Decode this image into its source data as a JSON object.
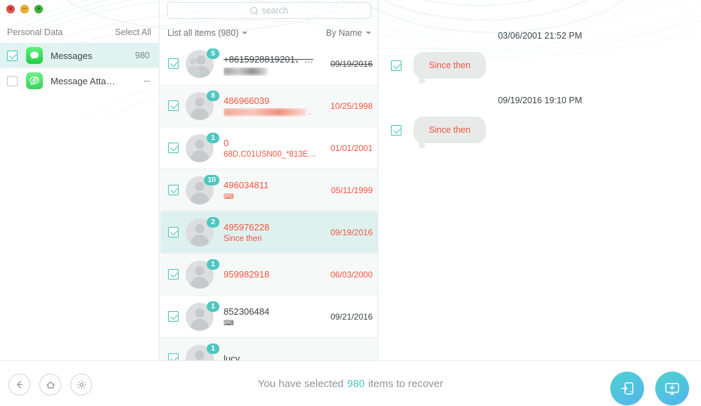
{
  "window": {
    "close_label": "×",
    "minimize_label": "−",
    "maximize_label": "+"
  },
  "sidebar": {
    "title": "Personal Data",
    "select_all_label": "Select All",
    "items": [
      {
        "label": "Messages",
        "count": "980",
        "checked": true,
        "icon": "messages-icon"
      },
      {
        "label": "Message Atta…",
        "count": "--",
        "checked": false,
        "icon": "message-attachments-icon"
      }
    ]
  },
  "list": {
    "search_placeholder": "search",
    "search_value": "",
    "filter_label": "List all items (980)",
    "sort_label": "By Name",
    "rows": [
      {
        "badge": "5",
        "title": "+8615928819201、…",
        "subtitle": "",
        "date": "09/19/2016",
        "red": false,
        "struck": true,
        "group": true,
        "sub_kind": "blur-gray",
        "sub_width": 62
      },
      {
        "badge": "8",
        "title": "486966039",
        "subtitle": "",
        "date": "10/25/1998",
        "red": true,
        "struck": false,
        "group": false,
        "sub_kind": "blur-red",
        "sub_width": 118
      },
      {
        "badge": "1",
        "title": "0",
        "subtitle": "68D.C01USN00_*813E…",
        "date": "01/01/2001",
        "red": true,
        "struck": false,
        "group": false,
        "sub_kind": "text",
        "sub_width": 0
      },
      {
        "badge": "10",
        "title": "496034811",
        "subtitle": "⌨",
        "date": "05/11/1999",
        "red": true,
        "struck": false,
        "group": false,
        "sub_kind": "glyph",
        "sub_width": 0
      },
      {
        "badge": "2",
        "title": "495976228",
        "subtitle": "Since then",
        "date": "09/19/2016",
        "red": true,
        "struck": false,
        "group": false,
        "sub_kind": "text",
        "sub_width": 0
      },
      {
        "badge": "1",
        "title": "959982918",
        "subtitle": "",
        "date": "06/03/2000",
        "red": true,
        "struck": false,
        "group": false,
        "sub_kind": "none",
        "sub_width": 0
      },
      {
        "badge": "1",
        "title": "852306484",
        "subtitle": "⌨",
        "date": "09/21/2016",
        "red": false,
        "struck": false,
        "group": false,
        "sub_kind": "glyph-dark",
        "sub_width": 0
      },
      {
        "badge": "1",
        "title": "lucy",
        "subtitle": "",
        "date": "",
        "red": false,
        "struck": false,
        "group": false,
        "sub_kind": "none",
        "sub_width": 0
      }
    ],
    "selected_index": 4
  },
  "chat": {
    "messages": [
      {
        "timestamp": "03/06/2001 21:52 PM",
        "text": "Since then",
        "checked": true
      },
      {
        "timestamp": "09/19/2016 19:10 PM",
        "text": "Since then",
        "checked": true
      }
    ]
  },
  "footer": {
    "back_icon": "back-arrow-icon",
    "home_icon": "home-icon",
    "settings_icon": "gear-icon",
    "status_prefix": "You have selected",
    "status_count": "980",
    "status_suffix": "items to recover",
    "recover_to_device_icon": "recover-to-device-icon",
    "recover_to_computer_icon": "recover-to-computer-icon"
  },
  "colors": {
    "accent": "#4ec7c0",
    "deleted_text": "#f2553d",
    "selected_row": "#dff1ef",
    "action_gradient_start": "#4fd3d0",
    "action_gradient_end": "#52b4ec"
  }
}
